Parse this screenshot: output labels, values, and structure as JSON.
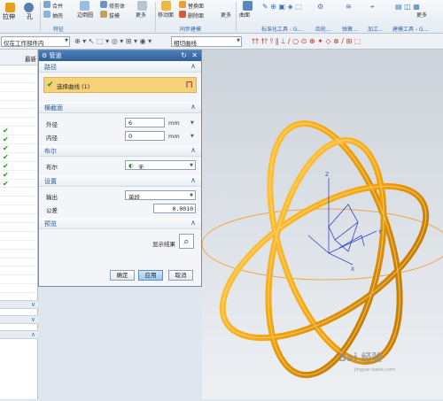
{
  "ribbon": {
    "items": [
      {
        "label": "拉伸",
        "name": "extrude-button"
      },
      {
        "label": "孔",
        "name": "hole-button"
      },
      {
        "label": "合并",
        "name": "unite-button"
      },
      {
        "label": "抽壳",
        "name": "shell-button"
      },
      {
        "label": "边倒圆",
        "name": "edge-blend-button"
      },
      {
        "label": "修剪体",
        "name": "trim-body-button"
      },
      {
        "label": "拔模",
        "name": "draft-button"
      },
      {
        "label": "更多",
        "name": "more-button-1"
      },
      {
        "label": "移动面",
        "name": "move-face-button"
      },
      {
        "label": "替换面",
        "name": "replace-face-button"
      },
      {
        "label": "删除面",
        "name": "delete-face-button"
      },
      {
        "label": "更多",
        "name": "more-button-2"
      },
      {
        "label": "曲面",
        "name": "surface-button"
      },
      {
        "label": "更多",
        "name": "more-button-3"
      }
    ],
    "groups": [
      "特征",
      "同步建模",
      "标准化工具 - G...",
      "齿轮...",
      "弹簧...",
      "加工...",
      "建模工具 - G..."
    ]
  },
  "toolbar": {
    "filter_select": "仅在工作部件内",
    "curve_rule_select": "相切曲线"
  },
  "navigator": {
    "header": "最新"
  },
  "dialog": {
    "title": "管道",
    "sections": {
      "path": "路径",
      "cross_section": "横截面",
      "boolean": "布尔",
      "settings": "设置",
      "preview": "预览"
    },
    "path_selection": "选择曲线 (1)",
    "outer_diameter": {
      "label": "外径",
      "value": "6",
      "unit": "mm"
    },
    "inner_diameter": {
      "label": "内径",
      "value": "0",
      "unit": "mm"
    },
    "boolean": {
      "label": "布尔",
      "value": "无"
    },
    "output": {
      "label": "输出",
      "value": "单段"
    },
    "tolerance": {
      "label": "公差",
      "value": "0.0010"
    },
    "preview": {
      "label": "显示结果"
    },
    "buttons": {
      "ok": "确定",
      "apply": "应用",
      "cancel": "取消"
    }
  },
  "viewport": {
    "axes": {
      "x": "X",
      "y": "Y",
      "z": "Z"
    },
    "pipe_color": "#f2a20c"
  },
  "watermark": {
    "main": "Bai 经验",
    "sub": "jingyan.baidu.com"
  }
}
